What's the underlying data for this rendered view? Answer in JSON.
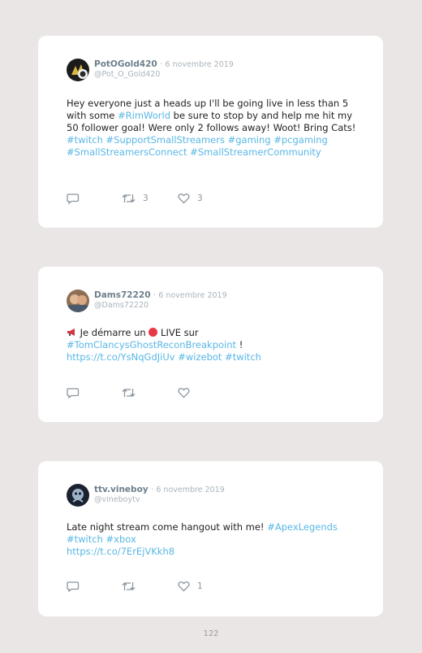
{
  "tweets": [
    {
      "name": "PotOGold420",
      "separator": "·",
      "date": "6 novembre 2019",
      "handle": "@Pot_O_Gold420",
      "text_parts": [
        {
          "t": "Hey everyone just a heads up I'll be going live in less than 5 with some ",
          "tag": false
        },
        {
          "t": "#RimWorld",
          "tag": true
        },
        {
          "t": " be sure to stop by and help me hit my 50 follower goal! Were only 2 follows away! Woot! Bring Cats!",
          "tag": false
        }
      ],
      "hashtags": "#twitch #SupportSmallStreamers #gaming #pcgaming #SmallStreamersConnect #SmallStreamerCommunity",
      "retweets": "3",
      "likes": "3"
    },
    {
      "name": "Dams72220",
      "separator": "·",
      "date": "6 novembre 2019",
      "handle": "@Dams72220",
      "line1_a": "Je démarre un",
      "line1_b": "LIVE sur",
      "tag_game": "#TomClancysGhostReconBreakpoint",
      "after_game": " !",
      "link": "https://t.co/YsNqGdJiUv",
      "tags_end": "#wizebot #twitch",
      "retweets": "",
      "likes": ""
    },
    {
      "name": "ttv.vineboy",
      "separator": "·",
      "date": "6 novembre 2019",
      "handle": "@vineboytv",
      "text": "Late night stream come hangout with me! ",
      "tag1": "#ApexLegends",
      "tags2": "#twitch #xbox",
      "link": "https://t.co/7ErEjVKkh8",
      "retweets": "",
      "likes": "1"
    }
  ],
  "page_number": "122"
}
